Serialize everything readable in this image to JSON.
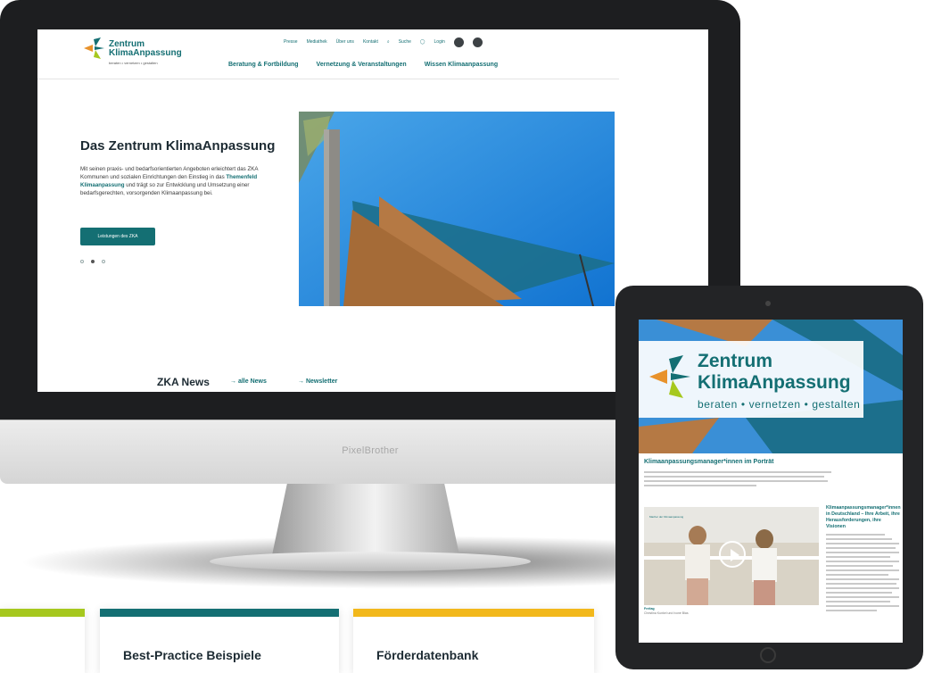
{
  "colors": {
    "teal": "#146f73",
    "green": "#a6c81e",
    "orange": "#e8922b",
    "yellow": "#f2b81b",
    "sky": "#1f86dd",
    "sail": "#b57944"
  },
  "monitor": {
    "brand": "PixelBrother"
  },
  "site": {
    "logo": {
      "name_line1": "Zentrum",
      "name_line2": "KlimaAnpassung",
      "tagline": "beraten • vernetzen • gestalten"
    },
    "meta_nav": [
      "Presse",
      "Mediathek",
      "Über uns",
      "Kontakt",
      "Suche",
      "Login"
    ],
    "icons": [
      "search-icon",
      "user-icon",
      "accessibility-icon",
      "language-icon"
    ],
    "main_nav": [
      "Beratung & Fortbildung",
      "Vernetzung & Veranstaltungen",
      "Wissen Klimaanpassung"
    ],
    "hero": {
      "title": "Das Zentrum KlimaAnpassung",
      "text_part1": "Mit seinen praxis- und bedarfsorientierten Angeboten erleichtert das ZKA Kommunen und sozialen Einrichtungen den Einstieg in das ",
      "text_link": "Themenfeld Klimaanpassung",
      "text_part2": " und trägt so zur Entwicklung und Umsetzung einer bedarfsgerechten, vorsorgenden Klimaanpassung bei.",
      "button": "Leistungen des ZKA"
    },
    "news": {
      "title": "ZKA News",
      "link_all": "→ alle News",
      "link_newsletter": "→ Newsletter"
    }
  },
  "cards": [
    {
      "title": "",
      "color": "#a6c81e"
    },
    {
      "title": "Best-Practice Beispiele",
      "color": "#146f73"
    },
    {
      "title": "Förderdatenbank",
      "color": "#f2b81b"
    }
  ],
  "tablet": {
    "logo": {
      "name_line1": "Zentrum",
      "name_line2": "KlimaAnpassung",
      "tagline": "beraten • vernetzen • gestalten"
    },
    "section_title": "Klimaanpassungsmanager*innen im Porträt",
    "side_title": "Klimaanpassungsmanager*innen in Deutschland – Ihre Arbeit, ihre Herausforderungen, ihre Visionen",
    "video_caption": "Freitag",
    "video_caption2": "Christina Kunkel und Ivone Blas",
    "video_logo": "Macher der Klimaanpassung"
  }
}
